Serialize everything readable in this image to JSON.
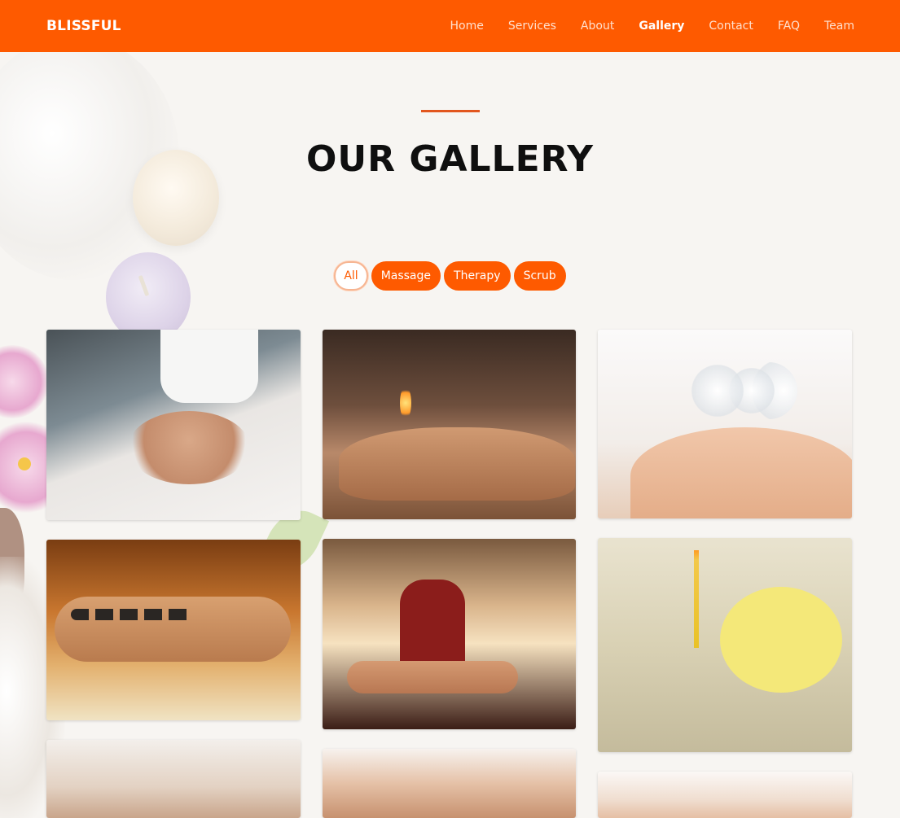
{
  "brand": {
    "name": "BLISSFUL",
    "accent_color": "#fe5a00"
  },
  "nav": {
    "items": [
      {
        "label": "Home"
      },
      {
        "label": "Services"
      },
      {
        "label": "About"
      },
      {
        "label": "Gallery",
        "active": true
      },
      {
        "label": "Contact"
      },
      {
        "label": "FAQ"
      },
      {
        "label": "Team"
      }
    ]
  },
  "section": {
    "title": "OUR GALLERY"
  },
  "filters": {
    "items": [
      {
        "label": "All",
        "active": true
      },
      {
        "label": "Massage"
      },
      {
        "label": "Therapy"
      },
      {
        "label": "Scrub"
      }
    ]
  },
  "gallery": {
    "images": [
      {
        "icon": "ear-candle-massage-photo"
      },
      {
        "icon": "fire-cupping-photo"
      },
      {
        "icon": "glass-cupping-photo"
      },
      {
        "icon": "hot-stone-massage-photo"
      },
      {
        "icon": "therapist-hot-stones-photo"
      },
      {
        "icon": "ear-candling-photo"
      },
      {
        "icon": "back-massage-photo"
      },
      {
        "icon": "neck-massage-photo"
      },
      {
        "icon": "face-massage-photo"
      }
    ]
  }
}
